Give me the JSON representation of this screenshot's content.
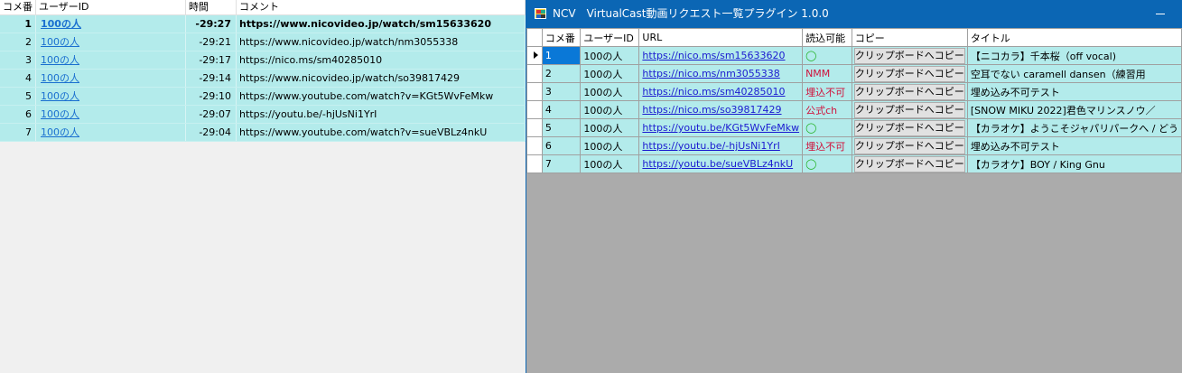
{
  "comment_list": {
    "columns": [
      "コメ番",
      "ユーザーID",
      "時間",
      "コメント"
    ],
    "rows": [
      {
        "no": "1",
        "user": "100の人",
        "time": "-29:27",
        "comment": "https://www.nicovideo.jp/watch/sm15633620"
      },
      {
        "no": "2",
        "user": "100の人",
        "time": "-29:21",
        "comment": "https://www.nicovideo.jp/watch/nm3055338"
      },
      {
        "no": "3",
        "user": "100の人",
        "time": "-29:17",
        "comment": "https://nico.ms/sm40285010"
      },
      {
        "no": "4",
        "user": "100の人",
        "time": "-29:14",
        "comment": "https://www.nicovideo.jp/watch/so39817429"
      },
      {
        "no": "5",
        "user": "100の人",
        "time": "-29:10",
        "comment": "https://www.youtube.com/watch?v=KGt5WvFeMkw"
      },
      {
        "no": "6",
        "user": "100の人",
        "time": "-29:07",
        "comment": "https://youtu.be/-hjUsNi1YrI"
      },
      {
        "no": "7",
        "user": "100の人",
        "time": "-29:04",
        "comment": "https://www.youtube.com/watch?v=sueVBLz4nkU"
      }
    ]
  },
  "plugin_window": {
    "title": "NCV　VirtualCast動画リクエスト一覧プラグイン 1.0.0",
    "icon": "app-icon",
    "columns": [
      "コメ番",
      "ユーザーID",
      "URL",
      "読込可能",
      "コピー",
      "タイトル"
    ],
    "copy_label": "クリップボードへコピー",
    "rows": [
      {
        "no": "1",
        "user": "100の人",
        "url": "https://nico.ms/sm15633620",
        "status": "◯",
        "status_type": "ok",
        "title": "【ニコカラ】千本桜（off vocal)"
      },
      {
        "no": "2",
        "user": "100の人",
        "url": "https://nico.ms/nm3055338",
        "status": "NMM",
        "status_type": "ng",
        "title": "空耳でない caramell dansen（練習用"
      },
      {
        "no": "3",
        "user": "100の人",
        "url": "https://nico.ms/sm40285010",
        "status": "埋込不可",
        "status_type": "ng",
        "title": "埋め込み不可テスト"
      },
      {
        "no": "4",
        "user": "100の人",
        "url": "https://nico.ms/so39817429",
        "status": "公式ch",
        "status_type": "ng",
        "title": "[SNOW MIKU 2022]君色マリンスノウ／"
      },
      {
        "no": "5",
        "user": "100の人",
        "url": "https://youtu.be/KGt5WvFeMkw",
        "status": "◯",
        "status_type": "ok",
        "title": "【カラオケ】ようこそジャパリパークへ / どう"
      },
      {
        "no": "6",
        "user": "100の人",
        "url": "https://youtu.be/-hjUsNi1YrI",
        "status": "埋込不可",
        "status_type": "ng",
        "title": "埋め込み不可テスト"
      },
      {
        "no": "7",
        "user": "100の人",
        "url": "https://youtu.be/sueVBLz4nkU",
        "status": "◯",
        "status_type": "ok",
        "title": "【カラオケ】BOY / King Gnu"
      }
    ]
  },
  "colors": {
    "row_bg": "#b3ebeb",
    "titlebar": "#0b66b4",
    "selection": "#0a78d7",
    "link": "#1b1bd0",
    "error": "#d0103a",
    "ok": "#1fb01f"
  }
}
